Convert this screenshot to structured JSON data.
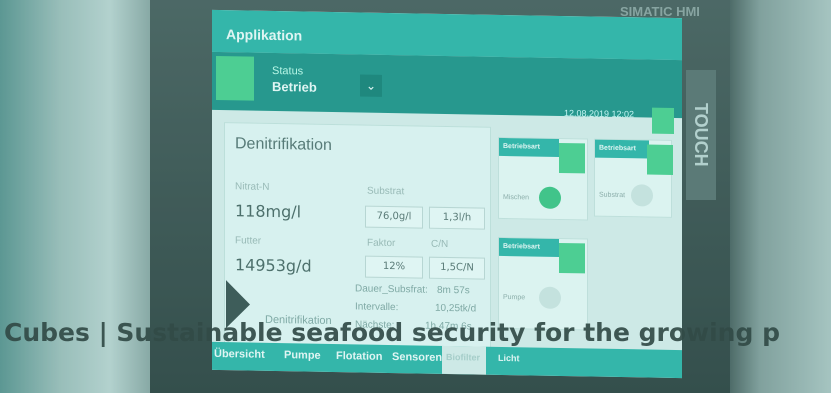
{
  "caption": "Cubes | Sustainable seafood security for the growing p",
  "hmi": {
    "brand": "SIMATIC HMI",
    "touch": "TOUCH",
    "app_title": "Applikation",
    "status_label": "Status",
    "status_value": "Betrieb",
    "datetime": "12.08.2019 12:02",
    "panel_title": "Denitrifikation",
    "nitrat_label": "Nitrat-N",
    "nitrat_value": "118mg/l",
    "substrat_label": "Substrat",
    "substrat_val1": "76,0g/l",
    "substrat_val2": "1,3l/h",
    "futter_label": "Futter",
    "futter_value": "14953g/d",
    "faktor_label": "Faktor",
    "faktor_value": "12%",
    "cn_label": "C/N",
    "cn_value": "1,5C/N",
    "dauer_label": "Dauer_Subsfrat:",
    "dauer_value": "8m 57s",
    "intervalle_label": "Intervalle:",
    "intervalle_value": "10,25tk/d",
    "naechste_label": "Nächste:",
    "naechste_value": "1h 47m 6s",
    "bottom_btn": "Denitrifikation",
    "cards": [
      {
        "head": "Betriebsart",
        "label": "Mischen"
      },
      {
        "head": "Betriebsart",
        "label": "Substrat"
      },
      {
        "head": "Betriebsart",
        "label": "Pumpe"
      }
    ],
    "tabs": [
      "Übersicht",
      "Pumpe",
      "Flotation",
      "Sensoren",
      "Biofilter",
      "Licht"
    ]
  }
}
